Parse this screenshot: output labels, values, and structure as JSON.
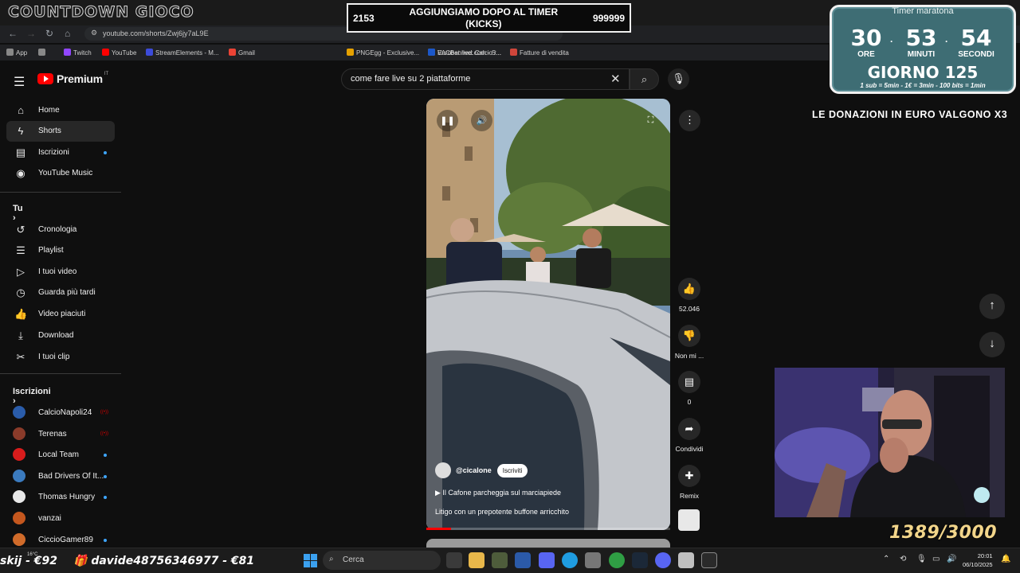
{
  "overlay": {
    "logo_title": "COUNTDOWN GIOCO",
    "subgoal_left": "2153",
    "subgoal_text": "AGGIUNGIAMO DOPO AL TIMER (KICKS)",
    "subgoal_right": "999999",
    "timer": {
      "header": "Timer maratona",
      "hours": "30",
      "minutes": "53",
      "seconds": "54",
      "hours_label": "ORE",
      "minutes_label": "MINUTI",
      "seconds_label": "SECONDI",
      "day": "GIORNO 125",
      "rules": "1 sub = 5min - 1€ = 3min - 100 bits = 1min"
    },
    "donations_note": "LE DONAZIONI IN EURO VALGONO X3",
    "goal_counter": "1389/3000",
    "ticker_left": "skij - €92",
    "ticker_main": "davide48756346977 - €81"
  },
  "browser": {
    "url": "youtube.com/shorts/Zwj6jy7aL9E",
    "bookmarks": [
      {
        "label": "App",
        "color": "#888888"
      },
      {
        "label": "",
        "color": "#888888"
      },
      {
        "label": "Twitch",
        "color": "#9146ff"
      },
      {
        "label": "YouTube",
        "color": "#ff0000"
      },
      {
        "label": "StreamElements - M...",
        "color": "#3c4bd9"
      },
      {
        "label": "Gmail",
        "color": "#ea4335"
      },
      {
        "label": "PNGEgg - Exclusive...",
        "color": "#e6a100"
      },
      {
        "label": "VACBanned.com - S...",
        "color": "#999999"
      },
      {
        "label": "Eurobet.live: Calcio r...",
        "color": "#1b57c9"
      },
      {
        "label": "Fatture di vendita",
        "color": "#d0463b"
      }
    ]
  },
  "youtube": {
    "brand": "Premium",
    "region": "IT",
    "search_value": "come fare live su 2 piattaforme",
    "nav": [
      {
        "label": "Home",
        "icon": "home-icon",
        "glyph": "⌂"
      },
      {
        "label": "Shorts",
        "icon": "shorts-icon",
        "glyph": "ϟ"
      },
      {
        "label": "Iscrizioni",
        "icon": "subscriptions-icon",
        "glyph": "▤"
      },
      {
        "label": "YouTube Music",
        "icon": "music-icon",
        "glyph": "◉"
      }
    ],
    "you_header": "Tu",
    "you_items": [
      {
        "label": "Cronologia",
        "icon": "history-icon",
        "glyph": "↺"
      },
      {
        "label": "Playlist",
        "icon": "playlist-icon",
        "glyph": "☰"
      },
      {
        "label": "I tuoi video",
        "icon": "your-videos-icon",
        "glyph": "▷"
      },
      {
        "label": "Guarda più tardi",
        "icon": "watch-later-icon",
        "glyph": "◷"
      },
      {
        "label": "Video piaciuti",
        "icon": "liked-icon",
        "glyph": "👍"
      },
      {
        "label": "Download",
        "icon": "download-icon",
        "glyph": "⤓"
      },
      {
        "label": "I tuoi clip",
        "icon": "clips-icon",
        "glyph": "✂"
      }
    ],
    "subs_header": "Iscrizioni",
    "subscriptions": [
      {
        "label": "CalcioNapoli24",
        "color": "#2a5caa",
        "indicator": "live"
      },
      {
        "label": "Terenas",
        "color": "#8a3b2a",
        "indicator": "live"
      },
      {
        "label": "Local Team",
        "color": "#d91c1c",
        "indicator": "dot"
      },
      {
        "label": "Bad Drivers Of It...",
        "color": "#3b7bbf",
        "indicator": "dot"
      },
      {
        "label": "Thomas Hungry",
        "color": "#e8e8e8",
        "indicator": "dot"
      },
      {
        "label": "vanzai",
        "color": "#c4571e",
        "indicator": ""
      },
      {
        "label": "CiccioGamer89",
        "color": "#d06b2a",
        "indicator": "dot"
      }
    ],
    "short": {
      "channel": "@cicalone",
      "subscribe": "Iscriviti",
      "title": "Il Cafone parcheggia sul marciapiede",
      "description": "Litigo con un prepotente buffone arricchito",
      "progress": 0.1,
      "likes": "52.046",
      "dislike_label": "Non mi ...",
      "comments": "0",
      "share_label": "Condividi",
      "remix_label": "Remix"
    }
  },
  "taskbar": {
    "search_placeholder": "Cerca",
    "weather": "16°C",
    "time": "20:01",
    "date": "06/10/2025"
  }
}
